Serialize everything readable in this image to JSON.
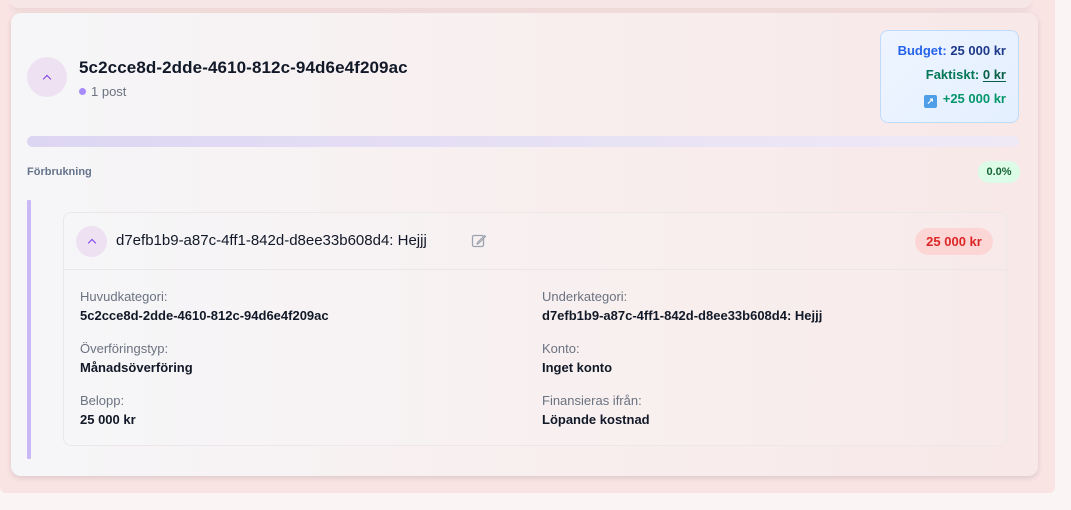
{
  "group": {
    "title": "5c2cce8d-2dde-4610-812c-94d6e4f209ac",
    "post_count": "1 post"
  },
  "budget": {
    "budget_label": "Budget:",
    "budget_value": "25 000 kr",
    "actual_label": "Faktiskt:",
    "actual_value": "0 kr",
    "difference": "+25 000 kr"
  },
  "usage": {
    "label": "Förbrukning",
    "percent_text": "0.0%",
    "fraction": 0.0
  },
  "item": {
    "title": "d7efb1b9-a87c-4ff1-842d-d8ee33b608d4: Hejjj",
    "amount": "25 000 kr",
    "fields": {
      "main_category_label": "Huvudkategori:",
      "main_category_value": "5c2cce8d-2dde-4610-812c-94d6e4f209ac",
      "sub_category_label": "Underkategori:",
      "sub_category_value": "d7efb1b9-a87c-4ff1-842d-d8ee33b608d4: Hejjj",
      "transfer_type_label": "Överföringstyp:",
      "transfer_type_value": "Månadsöverföring",
      "account_label": "Konto:",
      "account_value": "Inget konto",
      "amount_label": "Belopp:",
      "amount_value": "25 000 kr",
      "funded_from_label": "Finansieras ifrån:",
      "funded_from_value": "Löpande kostnad"
    }
  },
  "icons": {
    "collapse": "chevron-up-icon",
    "edit": "edit-icon",
    "trend": "trend-up-icon"
  },
  "colors": {
    "accent": "#a78bfa",
    "positive": "#059669",
    "negative": "#dc2626"
  }
}
